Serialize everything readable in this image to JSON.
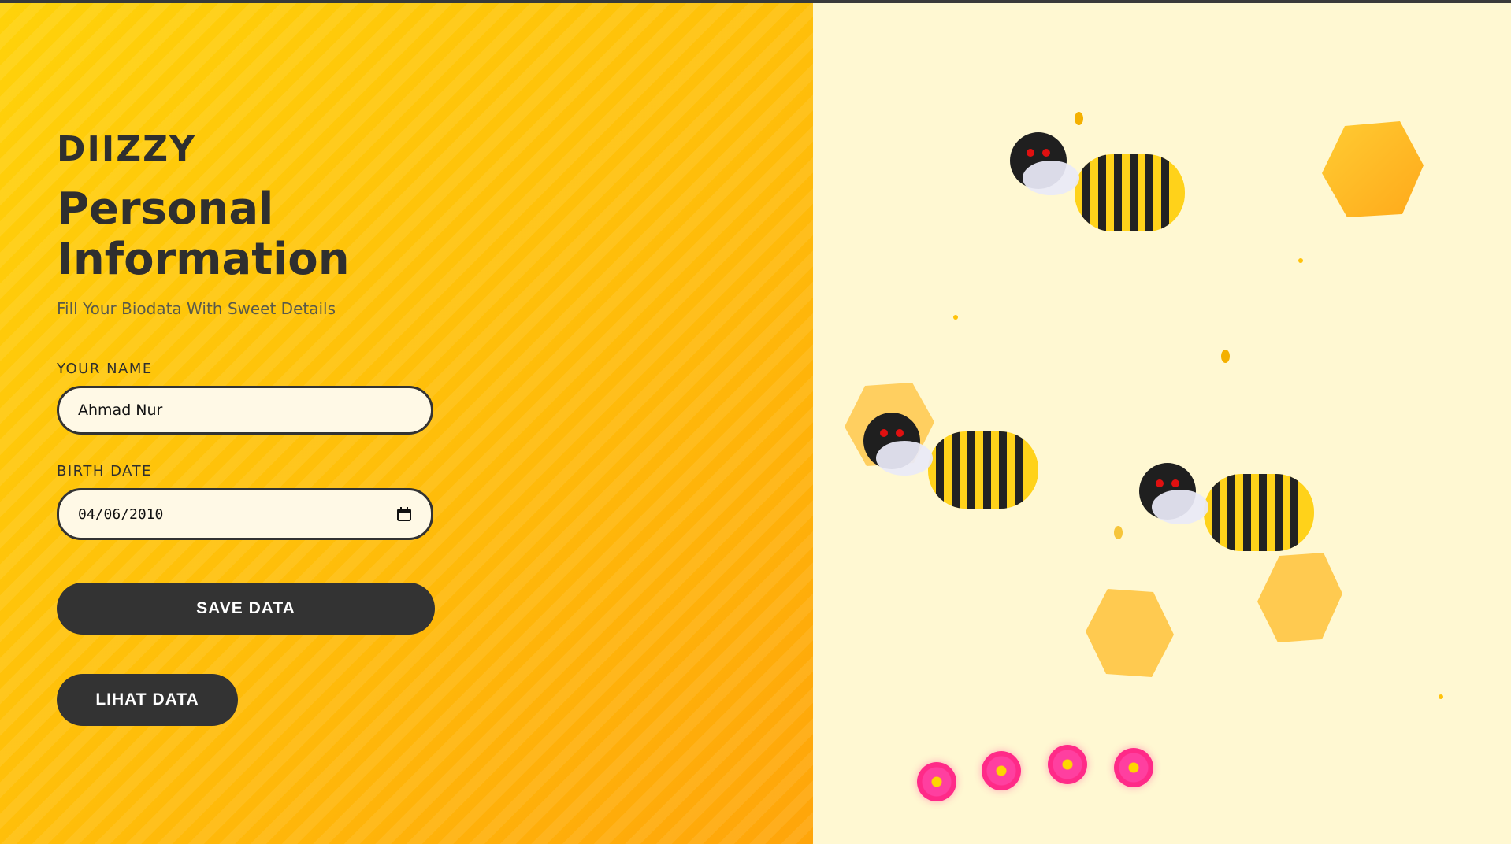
{
  "brand": "DIIZZY",
  "title": "Personal Information",
  "subtitle": "Fill Your Biodata With Sweet Details",
  "form": {
    "name_label": "YOUR NAME",
    "name_value": "Ahmad Nur",
    "birth_label": "BIRTH DATE",
    "birth_value": "04/06/2010",
    "calendar_icon": "calendar-icon"
  },
  "buttons": {
    "save": "SAVE DATA",
    "view": "LIHAT DATA"
  },
  "colors": {
    "left_panel": "#ffc20a",
    "right_panel": "#fff8d2",
    "button": "#333333",
    "flower": "#ff2a88"
  },
  "decor": {
    "bees": [
      "bee-icon",
      "bee-icon",
      "bee-icon"
    ],
    "honeycombs": [
      "hexagon-icon",
      "hexagon-icon",
      "hexagon-icon",
      "hexagon-icon"
    ],
    "flowers": [
      "flower-icon",
      "flower-icon",
      "flower-icon",
      "flower-icon"
    ]
  }
}
